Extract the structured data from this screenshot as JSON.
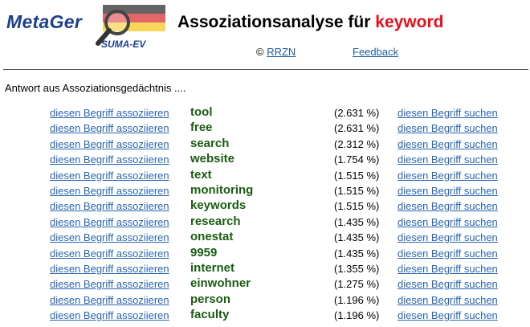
{
  "header": {
    "logo_text": "MetaGer",
    "logo_sub": "SUMA-EV",
    "title_prefix": "Assoziationsanalyse für",
    "title_keyword": "keyword",
    "copyright_symbol": "©",
    "copyright_link": "RRZN",
    "feedback_link": "Feedback"
  },
  "intro": "Antwort aus Assoziationsgedächtnis ....",
  "rows": [
    {
      "assoc": "diesen Begriff assoziieren",
      "term": "tool",
      "pct": "(2.631 %)",
      "search": "diesen Begriff suchen"
    },
    {
      "assoc": "diesen Begriff assoziieren",
      "term": "free",
      "pct": "(2.631 %)",
      "search": "diesen Begriff suchen"
    },
    {
      "assoc": "diesen Begriff assoziieren",
      "term": "search",
      "pct": "(2.312 %)",
      "search": "diesen Begriff suchen"
    },
    {
      "assoc": "diesen Begriff assoziieren",
      "term": "website",
      "pct": "(1.754 %)",
      "search": "diesen Begriff suchen"
    },
    {
      "assoc": "diesen Begriff assoziieren",
      "term": "text",
      "pct": "(1.515 %)",
      "search": "diesen Begriff suchen"
    },
    {
      "assoc": "diesen Begriff assoziieren",
      "term": "monitoring",
      "pct": "(1.515 %)",
      "search": "diesen Begriff suchen"
    },
    {
      "assoc": "diesen Begriff assoziieren",
      "term": "keywords",
      "pct": "(1.515 %)",
      "search": "diesen Begriff suchen"
    },
    {
      "assoc": "diesen Begriff assoziieren",
      "term": "research",
      "pct": "(1.435 %)",
      "search": "diesen Begriff suchen"
    },
    {
      "assoc": "diesen Begriff assoziieren",
      "term": "onestat",
      "pct": "(1.435 %)",
      "search": "diesen Begriff suchen"
    },
    {
      "assoc": "diesen Begriff assoziieren",
      "term": "9959",
      "pct": "(1.435 %)",
      "search": "diesen Begriff suchen"
    },
    {
      "assoc": "diesen Begriff assoziieren",
      "term": "internet",
      "pct": "(1.355 %)",
      "search": "diesen Begriff suchen"
    },
    {
      "assoc": "diesen Begriff assoziieren",
      "term": "einwohner",
      "pct": "(1.275 %)",
      "search": "diesen Begriff suchen"
    },
    {
      "assoc": "diesen Begriff assoziieren",
      "term": "person",
      "pct": "(1.196 %)",
      "search": "diesen Begriff suchen"
    },
    {
      "assoc": "diesen Begriff assoziieren",
      "term": "faculty",
      "pct": "(1.196 %)",
      "search": "diesen Begriff suchen"
    }
  ],
  "colors": {
    "link": "#2a66b1",
    "term": "#1a5c12",
    "keyword": "#e8101a",
    "logo": "#1d3f8f"
  },
  "icons": {
    "logo_graphic": "magnifier-flag-icon"
  }
}
